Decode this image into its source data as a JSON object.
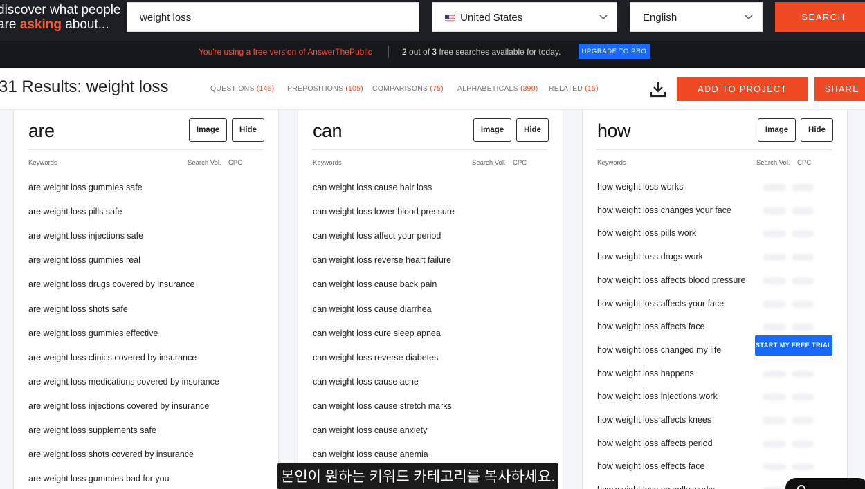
{
  "header": {
    "tagline_line1": "discover what people",
    "tagline_line2_prefix": "are ",
    "tagline_accent": "asking",
    "tagline_line2_suffix": " about...",
    "search_value": "weight loss",
    "country": "United States",
    "language": "English",
    "search_label": "SEARCH"
  },
  "notice": {
    "free_text": "You're using a free version of AnswerThePublic",
    "used": "2",
    "out_of": " out of ",
    "total": "3",
    "rest": " free searches available for today.",
    "upgrade_label": "UPGRADE TO PRO"
  },
  "results": {
    "title": "31 Results: weight loss",
    "tabs": [
      {
        "label": "QUESTIONS",
        "count": "(146)"
      },
      {
        "label": "PREPOSITIONS",
        "count": "(105)"
      },
      {
        "label": "COMPARISONS",
        "count": "(75)"
      },
      {
        "label": "ALPHABETICALS",
        "count": "(390)"
      },
      {
        "label": "RELATED",
        "count": "(15)"
      }
    ],
    "add_project_label": "ADD TO PROJECT",
    "share_label": "SHARE"
  },
  "columns": [
    {
      "title": "are",
      "image_label": "Image",
      "hide_label": "Hide",
      "head_keywords": "Keywords",
      "head_volume": "Search Vol.",
      "head_cpc": "CPC",
      "keywords": [
        "are weight loss gummies safe",
        "are weight loss pills safe",
        "are weight loss injections safe",
        "are weight loss gummies real",
        "are weight loss drugs covered by insurance",
        "are weight loss shots safe",
        "are weight loss gummies effective",
        "are weight loss clinics covered by insurance",
        "are weight loss medications covered by insurance",
        "are weight loss injections covered by insurance",
        "are weight loss supplements safe",
        "are weight loss shots covered by insurance",
        "are weight loss gummies bad for you"
      ]
    },
    {
      "title": "can",
      "image_label": "Image",
      "hide_label": "Hide",
      "head_keywords": "Keywords",
      "head_volume": "Search Vol.",
      "head_cpc": "CPC",
      "keywords": [
        "can weight loss cause hair loss",
        "can weight loss lower blood pressure",
        "can weight loss affect your period",
        "can weight loss reverse heart failure",
        "can weight loss cause back pain",
        "can weight loss cause diarrhea",
        "can weight loss cure sleep apnea",
        "can weight loss reverse diabetes",
        "can weight loss cause acne",
        "can weight loss cause stretch marks",
        "can weight loss cause anxiety",
        "can weight loss cause anemia"
      ]
    },
    {
      "title": "how",
      "image_label": "Image",
      "hide_label": "Hide",
      "head_keywords": "Keywords",
      "head_volume": "Search Vol.",
      "head_cpc": "CPC",
      "trial_label": "START MY FREE TRIAL",
      "keywords": [
        "how weight loss works",
        "how weight loss changes your face",
        "how weight loss pills work",
        "how weight loss drugs work",
        "how weight loss affects blood pressure",
        "how weight loss affects your face",
        "how weight loss affects face",
        "how weight loss changed my life",
        "how weight loss happens",
        "how weight loss injections work",
        "how weight loss affects knees",
        "how weight loss affects period",
        "how weight loss effects face",
        "how weight loss actually works"
      ]
    }
  ],
  "subtitle": "본인이 원하는 키워드 카테고리를 복사하세요.",
  "colors": {
    "accent": "#f04a24",
    "pro_blue": "#1769ff",
    "topbar": "#1e1f24"
  }
}
